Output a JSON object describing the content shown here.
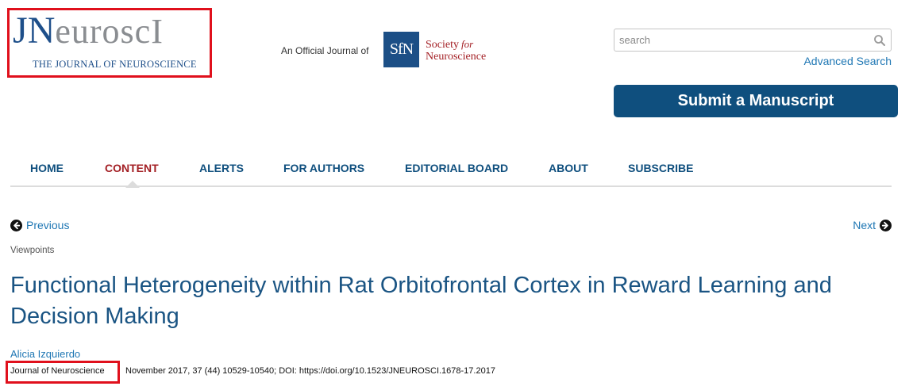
{
  "header": {
    "logo": {
      "j": "J",
      "n": "N",
      "rest": "euroscI",
      "subtitle": "THE JOURNAL OF NEUROSCIENCE"
    },
    "official_journal_text": "An Official Journal of",
    "sfn": {
      "mark": "SfN",
      "society": "Society",
      "for": "for",
      "neuroscience": "Neuroscience"
    },
    "search": {
      "placeholder": "search",
      "advanced_label": "Advanced Search"
    },
    "submit_label": "Submit a Manuscript"
  },
  "nav": {
    "items": [
      {
        "label": "HOME",
        "active": false
      },
      {
        "label": "CONTENT",
        "active": true
      },
      {
        "label": "ALERTS",
        "active": false
      },
      {
        "label": "FOR AUTHORS",
        "active": false
      },
      {
        "label": "EDITORIAL BOARD",
        "active": false
      },
      {
        "label": "ABOUT",
        "active": false
      },
      {
        "label": "SUBSCRIBE",
        "active": false
      }
    ]
  },
  "pager": {
    "previous_label": "Previous",
    "next_label": "Next"
  },
  "article": {
    "section": "Viewpoints",
    "title": "Functional Heterogeneity within Rat Orbitofrontal Cortex in Reward Learning and Decision Making",
    "author": "Alicia Izquierdo",
    "journal": "Journal of Neuroscience",
    "citation": "November 2017, 37 (44) 10529-10540; DOI: https://doi.org/10.1523/JNEUROSCI.1678-17.2017"
  },
  "colors": {
    "brand_blue": "#0f4f7e",
    "link_blue": "#1f77b4",
    "active_red": "#a31f24",
    "highlight_red": "#e0101c"
  },
  "icons": [
    "search-icon",
    "arrow-left-circle-icon",
    "arrow-right-circle-icon"
  ]
}
